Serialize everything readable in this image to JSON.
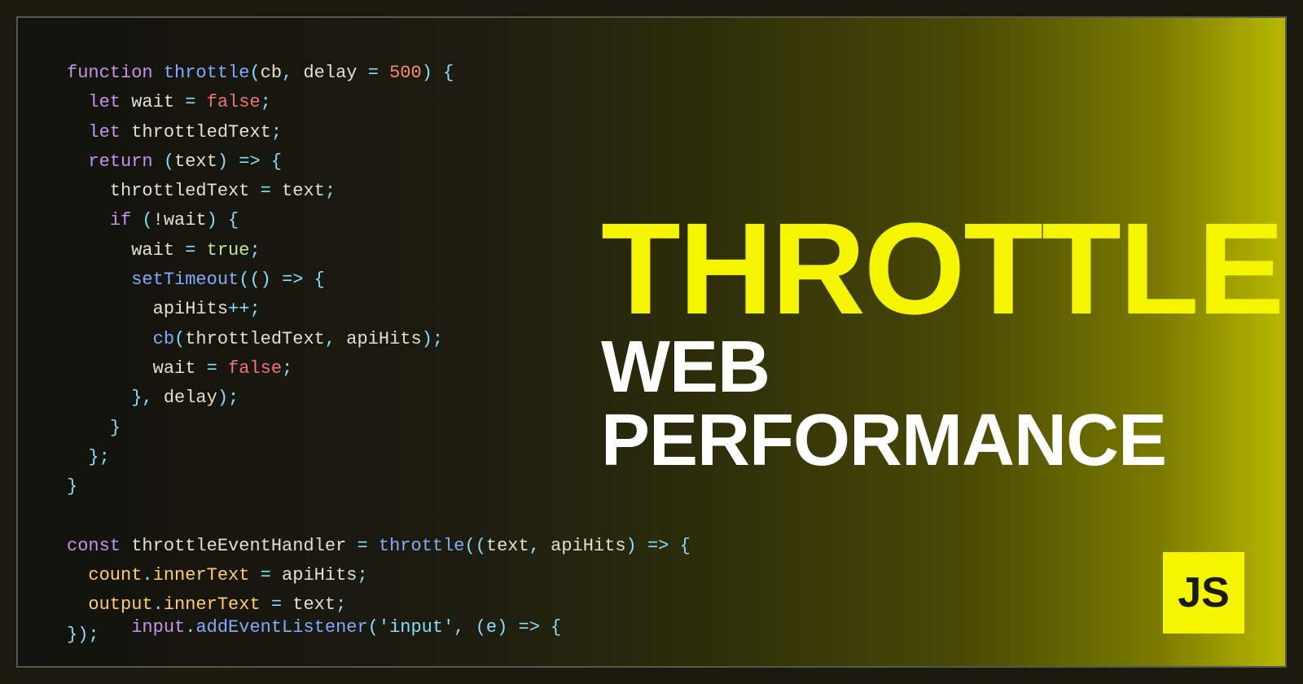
{
  "page": {
    "title": "Throttle Web Performance",
    "background": {
      "left_color": "#12120e",
      "right_color": "#b8b800"
    }
  },
  "code": {
    "lines": [
      {
        "id": 1,
        "text": "function throttle(cb, delay = 500) {"
      },
      {
        "id": 2,
        "text": "  let wait = false;"
      },
      {
        "id": 3,
        "text": "  let throttledText;"
      },
      {
        "id": 4,
        "text": "  return (text) => {"
      },
      {
        "id": 5,
        "text": "    throttledText = text;"
      },
      {
        "id": 6,
        "text": "    if (!wait) {"
      },
      {
        "id": 7,
        "text": "      wait = true;"
      },
      {
        "id": 8,
        "text": "      setTimeout(() => {"
      },
      {
        "id": 9,
        "text": "        apiHits++;"
      },
      {
        "id": 10,
        "text": "        cb(throttledText, apiHits);"
      },
      {
        "id": 11,
        "text": "        wait = false;"
      },
      {
        "id": 12,
        "text": "      }, delay);"
      },
      {
        "id": 13,
        "text": "    }"
      },
      {
        "id": 14,
        "text": "  };"
      },
      {
        "id": 15,
        "text": "}"
      },
      {
        "id": 16,
        "text": ""
      },
      {
        "id": 17,
        "text": "const throttleEventHandler = throttle((text, apiHits) => {"
      },
      {
        "id": 18,
        "text": "  count.innerText = apiHits;"
      },
      {
        "id": 19,
        "text": "  output.innerText = text;"
      },
      {
        "id": 20,
        "text": "});"
      }
    ],
    "bottom_partial": "  input.addEventListener('input', (e) => {"
  },
  "titles": {
    "line1": "THROTTLE",
    "line2": "WEB PERFORMANCE"
  },
  "badge": {
    "text": "JS",
    "bg_color": "#f5f500",
    "text_color": "#1a1a0e"
  }
}
